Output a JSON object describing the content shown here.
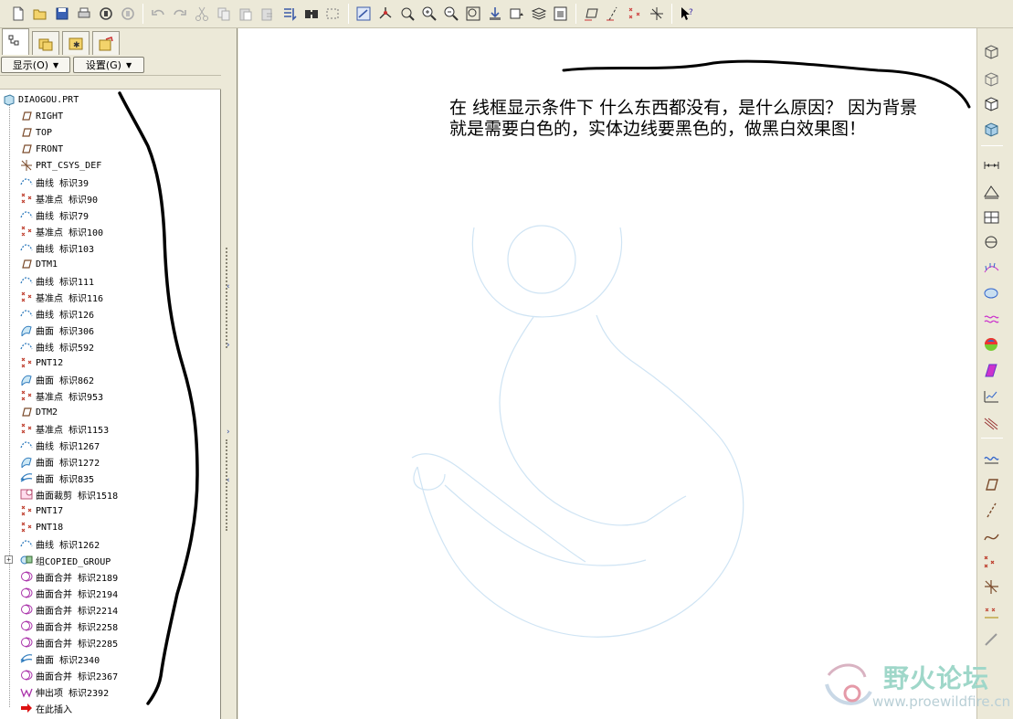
{
  "toolbar": {
    "buttons": [
      "new-icon",
      "open-icon",
      "save-icon",
      "print-icon",
      "email-icon",
      "email-disabled-icon",
      "undo-icon",
      "redo-icon",
      "cut-icon",
      "copy-icon",
      "paste-icon",
      "paste-special-icon",
      "regenerate-icon",
      "find-icon",
      "select-box-icon",
      "repaint-icon",
      "spin-center-icon",
      "orient-icon",
      "zoom-in-icon",
      "zoom-out-icon",
      "refit-icon",
      "reorient-icon",
      "saved-views-icon",
      "layers-icon",
      "display-style-icon",
      "datum-planes-toggle-icon",
      "datum-axes-toggle-icon",
      "datum-points-toggle-icon",
      "csys-toggle-icon",
      "context-help-icon"
    ]
  },
  "navigator": {
    "tabs": [
      "model-tree-tab",
      "folder-browser-tab",
      "favorites-tab",
      "connections-tab"
    ],
    "show_menu": "显示(O)",
    "settings_menu": "设置(G)"
  },
  "model_tree": {
    "root": "DIAOGOU.PRT",
    "items": [
      {
        "label": "RIGHT",
        "icon": "datum-plane-icon"
      },
      {
        "label": "TOP",
        "icon": "datum-plane-icon"
      },
      {
        "label": "FRONT",
        "icon": "datum-plane-icon"
      },
      {
        "label": "PRT_CSYS_DEF",
        "icon": "csys-icon"
      },
      {
        "label": "曲线 标识39",
        "icon": "curve-icon"
      },
      {
        "label": "基准点 标识90",
        "icon": "datum-point-icon"
      },
      {
        "label": "曲线 标识79",
        "icon": "curve-icon"
      },
      {
        "label": "基准点 标识100",
        "icon": "datum-point-icon"
      },
      {
        "label": "曲线 标识103",
        "icon": "curve-icon"
      },
      {
        "label": "DTM1",
        "icon": "datum-plane-icon"
      },
      {
        "label": "曲线 标识111",
        "icon": "curve-icon"
      },
      {
        "label": "基准点 标识116",
        "icon": "datum-point-icon"
      },
      {
        "label": "曲线 标识126",
        "icon": "curve-icon"
      },
      {
        "label": "曲面 标识306",
        "icon": "surface-icon"
      },
      {
        "label": "曲线 标识592",
        "icon": "curve-icon"
      },
      {
        "label": "PNT12",
        "icon": "datum-point-icon"
      },
      {
        "label": "曲面 标识862",
        "icon": "surface-icon"
      },
      {
        "label": "基准点 标识953",
        "icon": "datum-point-icon"
      },
      {
        "label": "DTM2",
        "icon": "datum-plane-icon"
      },
      {
        "label": "基准点 标识1153",
        "icon": "datum-point-icon"
      },
      {
        "label": "曲线 标识1267",
        "icon": "curve-icon"
      },
      {
        "label": "曲面 标识1272",
        "icon": "surface-icon"
      },
      {
        "label": "曲面 标识835",
        "icon": "boundary-surface-icon"
      },
      {
        "label": "曲面裁剪 标识1518",
        "icon": "trim-icon"
      },
      {
        "label": "PNT17",
        "icon": "datum-point-icon"
      },
      {
        "label": "PNT18",
        "icon": "datum-point-icon"
      },
      {
        "label": "曲线 标识1262",
        "icon": "curve-icon"
      },
      {
        "label": "组COPIED_GROUP",
        "icon": "group-icon"
      },
      {
        "label": "曲面合并 标识2189",
        "icon": "merge-icon"
      },
      {
        "label": "曲面合并 标识2194",
        "icon": "merge-icon"
      },
      {
        "label": "曲面合并 标识2214",
        "icon": "merge-icon"
      },
      {
        "label": "曲面合并 标识2258",
        "icon": "merge-icon"
      },
      {
        "label": "曲面合并 标识2285",
        "icon": "merge-icon"
      },
      {
        "label": "曲面 标识2340",
        "icon": "boundary-surface-icon"
      },
      {
        "label": "曲面合并 标识2367",
        "icon": "merge-icon"
      },
      {
        "label": "伸出项 标识2392",
        "icon": "protrusion-icon"
      },
      {
        "label": "在此插入",
        "icon": "insert-here-icon"
      }
    ]
  },
  "canvas": {
    "note": "在 线框显示条件下 什么东西都没有，是什么原因？ 因为背景就是需要白色的，实体边线要黑色的，做黑白效果图！"
  },
  "right_toolbar": {
    "buttons": [
      "wireframe-icon",
      "hidden-line-icon",
      "no-hidden-icon",
      "shading-icon",
      "measure-icon",
      "area-icon",
      "mass-props-icon",
      "clearance-icon",
      "curvature-icon",
      "section-analysis-icon",
      "deviation-icon",
      "draft-icon",
      "shading-analysis-icon",
      "graph-icon",
      "offset-analysis-icon",
      "sketch-icon",
      "datum-plane-tool-icon",
      "datum-axis-tool-icon",
      "datum-curve-tool-icon",
      "datum-point-tool-icon",
      "csys-tool-icon",
      "analysis-feature-icon",
      "chain-icon"
    ]
  },
  "watermark": {
    "brand": "野火论坛",
    "url": "www.proewildfire.cn"
  },
  "colors": {
    "ui_background": "#ece9d8",
    "wireframe_line": "#cfe4f4",
    "annotation_ink": "#000000",
    "watermark": "#9fd7c9"
  }
}
